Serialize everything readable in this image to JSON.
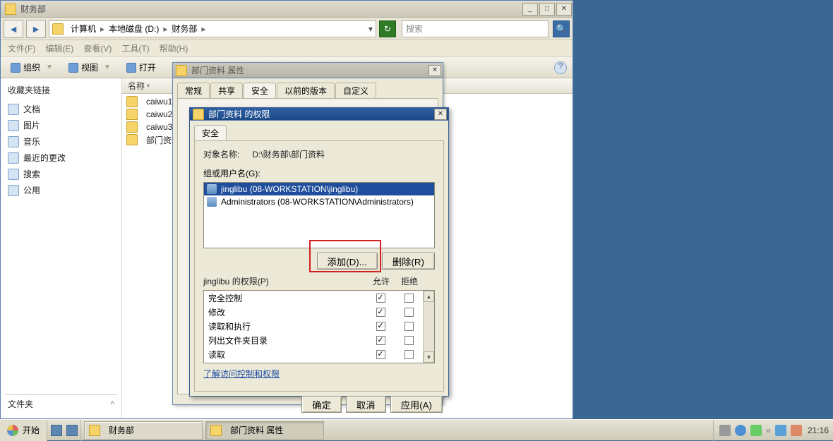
{
  "explorer": {
    "title": "财务部",
    "breadcrumbs": [
      "计算机",
      "本地磁盘 (D:)",
      "财务部"
    ],
    "search_placeholder": "搜索",
    "menu": {
      "file": "文件(F)",
      "edit": "编辑(E)",
      "view": "查看(V)",
      "tools": "工具(T)",
      "help": "帮助(H)"
    },
    "toolbar": {
      "organize": "组织",
      "views": "视图",
      "open": "打开"
    },
    "sidebar": {
      "header": "收藏夹链接",
      "items": [
        {
          "label": "文档"
        },
        {
          "label": "图片"
        },
        {
          "label": "音乐"
        },
        {
          "label": "最近的更改"
        },
        {
          "label": "搜索"
        },
        {
          "label": "公用"
        }
      ],
      "footer": "文件夹"
    },
    "list": {
      "col_name": "名称",
      "items": [
        {
          "name": "caiwu1"
        },
        {
          "name": "caiwu2"
        },
        {
          "name": "caiwu3"
        },
        {
          "name": "部门资料"
        }
      ]
    }
  },
  "props_dialog": {
    "title": "部门资料 属性",
    "tabs": {
      "general": "常规",
      "share": "共享",
      "security": "安全",
      "prev": "以前的版本",
      "custom": "自定义"
    }
  },
  "perm_dialog": {
    "title": "部门资料 的权限",
    "tab_security": "安全",
    "object_label": "对象名称:",
    "object_value": "D:\\财务部\\部门资料",
    "group_label": "组或用户名(G):",
    "users": [
      {
        "name": "jinglibu (08-WORKSTATION\\jinglibu)",
        "selected": true
      },
      {
        "name": "Administrators (08-WORKSTATION\\Administrators)",
        "selected": false
      }
    ],
    "btn_add": "添加(D)...",
    "btn_remove": "删除(R)",
    "perm_for_label": "jinglibu 的权限(P)",
    "col_allow": "允许",
    "col_deny": "拒绝",
    "perms": [
      {
        "label": "完全控制",
        "allow": true,
        "deny": false
      },
      {
        "label": "修改",
        "allow": true,
        "deny": false
      },
      {
        "label": "读取和执行",
        "allow": true,
        "deny": false
      },
      {
        "label": "列出文件夹目录",
        "allow": true,
        "deny": false
      },
      {
        "label": "读取",
        "allow": true,
        "deny": false
      }
    ],
    "link": "了解访问控制和权限",
    "btn_ok": "确定",
    "btn_cancel": "取消",
    "btn_apply": "应用(A)"
  },
  "taskbar": {
    "start": "开始",
    "tasks": [
      {
        "label": "财务部",
        "active": false
      },
      {
        "label": "部门资料 属性",
        "active": true
      }
    ],
    "clock": "21:16"
  }
}
